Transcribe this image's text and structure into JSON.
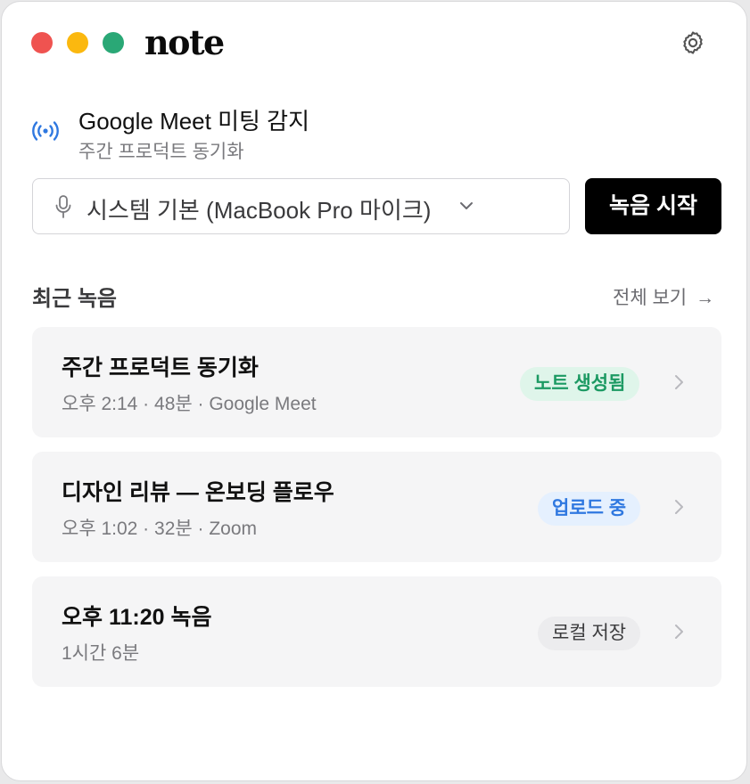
{
  "app": {
    "name": "note"
  },
  "detection": {
    "title": "Google Meet 미팅 감지",
    "subtitle": "주간 프로덕트 동기화",
    "icon": "broadcast-icon",
    "icon_color": "#2f78e0"
  },
  "recorder": {
    "mic_value": "시스템 기본 (MacBook Pro 마이크)",
    "start_label": "녹음 시작"
  },
  "recent": {
    "heading": "최근 녹음",
    "view_all_label": "전체 보기",
    "items": [
      {
        "title": "주간 프로덕트 동기화",
        "meta": "오후 2:14 · 48분 · Google Meet",
        "badge": "노트 생성됨",
        "badge_color": "#1c9a63"
      },
      {
        "title": "디자인 리뷰 — 온보딩 플로우",
        "meta": "오후 1:02 · 32분 · Zoom",
        "badge": "업로드 중",
        "badge_color": "#2f78e0"
      },
      {
        "title": "오후 11:20 녹음",
        "meta": "1시간 6분",
        "badge": "로컬 저장",
        "badge_color": "#3a3a3c"
      }
    ]
  },
  "colors": {
    "traffic_red": "#ef5350",
    "traffic_yellow": "#fbb80f",
    "traffic_green": "#2aa876",
    "primary_button": "#000000"
  }
}
